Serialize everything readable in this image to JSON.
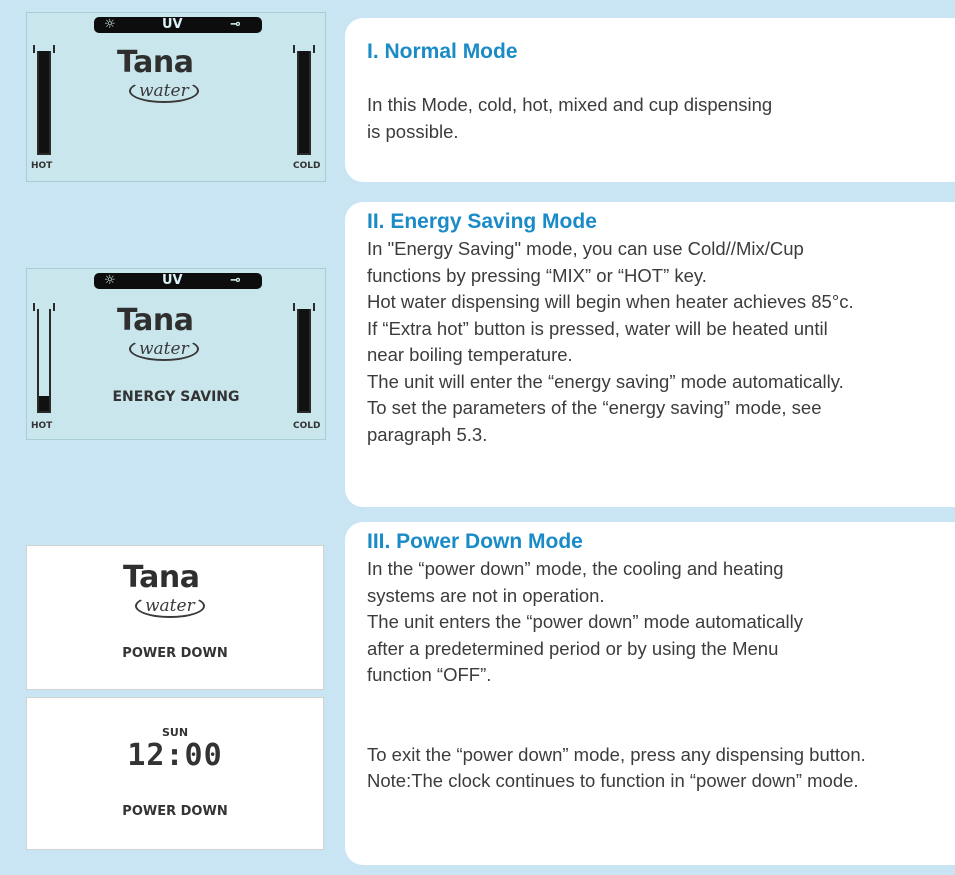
{
  "sections": [
    {
      "title": "I. Normal Mode",
      "body": "In this Mode, cold, hot, mixed and cup dispensing\n is possible."
    },
    {
      "title": "II. Energy Saving Mode",
      "body": "In \"Energy Saving\" mode, you can use Cold//Mix/Cup\nfunctions by pressing “MIX” or “HOT” key.\nHot water dispensing will begin when heater achieves 85°c.\nIf “Extra hot” button is pressed, water will be heated until\nnear boiling temperature.\nThe unit will enter the “energy saving” mode automatically.\nTo set the parameters of the “energy saving” mode, see\nparagraph 5.3."
    },
    {
      "title": "III. Power Down Mode",
      "body": "In the “power down” mode, the cooling and heating\nsystems are not in operation.\nThe unit enters the “power down” mode automatically\nafter a predetermined period or by using the Menu\n function “OFF”.\n\n\nTo exit the “power down” mode, press any dispensing button.\nNote:The clock continues to function in “power down” mode."
    }
  ],
  "displays": {
    "status_uv": "UV",
    "brand_name": "Tana",
    "brand_sub": "water",
    "hot_label": "HOT",
    "cold_label": "COLD",
    "energy_caption": "ENERGY SAVING",
    "power_caption": "POWER DOWN",
    "clock_day": "SUN",
    "clock_time": "12:00"
  },
  "levels": {
    "normal_hot": 1.0,
    "normal_cold": 1.0,
    "energy_hot": 0.15,
    "energy_cold": 1.0
  },
  "colors": {
    "background": "#c9e4f2",
    "heading": "#1a8bc6",
    "lcd": "#c8e6ec"
  }
}
